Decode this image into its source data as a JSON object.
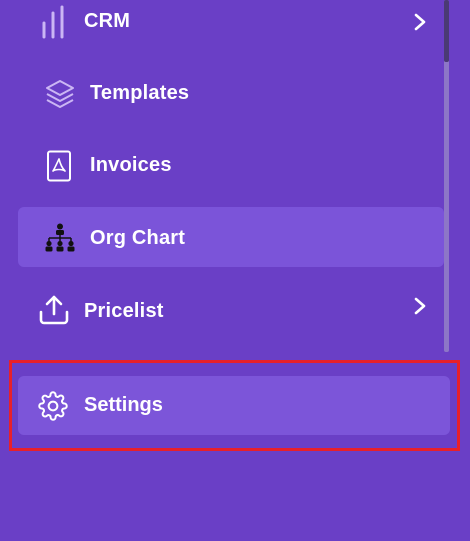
{
  "nav": {
    "items": [
      {
        "label": "CRM",
        "icon": "bar-chart-icon",
        "has_chevron": true
      },
      {
        "label": "Templates",
        "icon": "layers-icon",
        "has_chevron": false
      },
      {
        "label": "Invoices",
        "icon": "pdf-document-icon",
        "has_chevron": false
      },
      {
        "label": "Org Chart",
        "icon": "org-chart-icon",
        "has_chevron": false,
        "active": true
      },
      {
        "label": "Pricelist",
        "icon": "upload-icon",
        "has_chevron": true
      }
    ],
    "settings": {
      "label": "Settings",
      "icon": "gear-icon",
      "highlighted": true
    }
  },
  "colors": {
    "sidebar_bg": "#6a3fc6",
    "active_bg": "#7b54d9",
    "text": "#ffffff",
    "highlight_border": "#e8202a"
  }
}
